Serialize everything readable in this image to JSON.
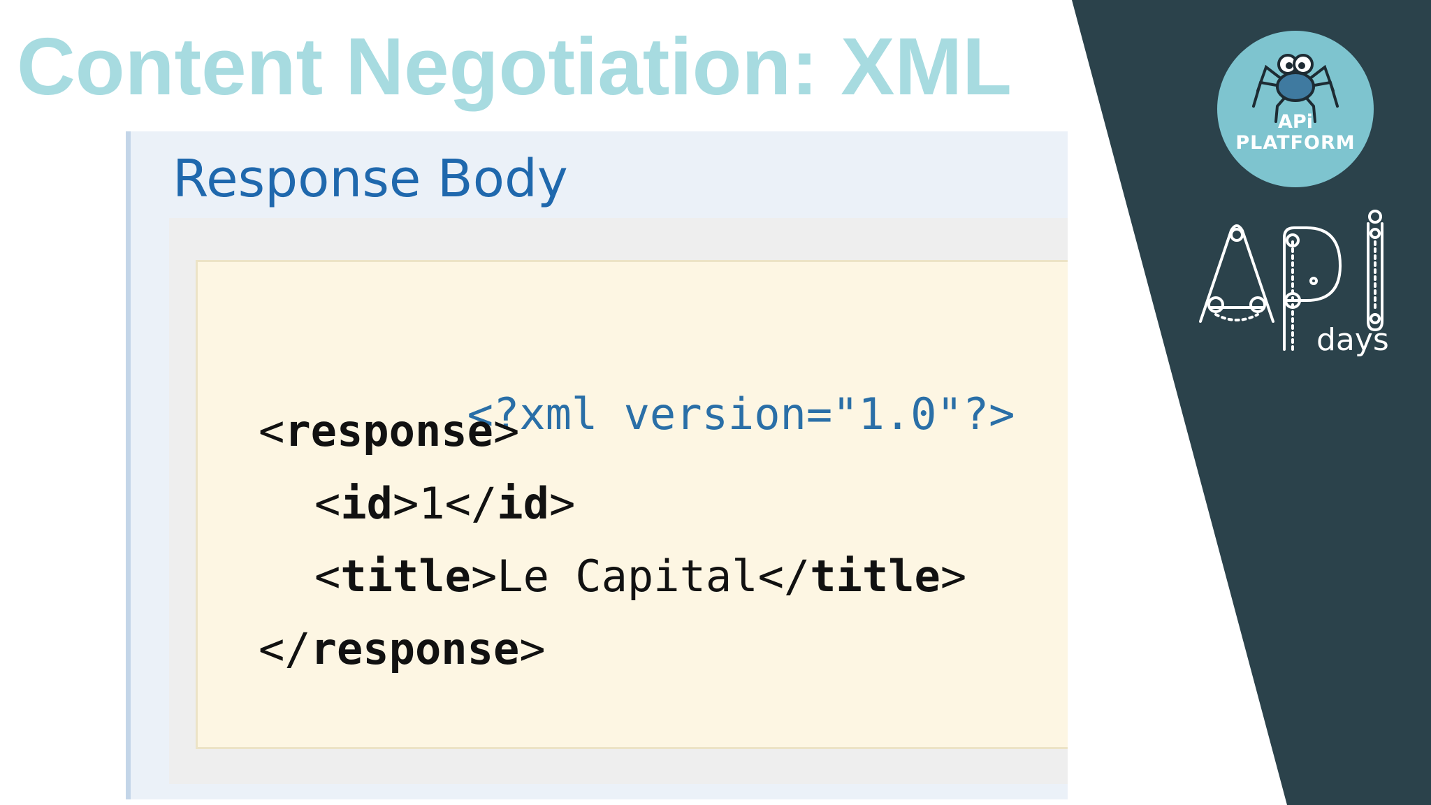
{
  "slide": {
    "title": "Content Negotiation: XML"
  },
  "panel": {
    "heading": "Response Body"
  },
  "code": {
    "declaration": "<?xml version=\"1.0\"?>",
    "root_open": "response",
    "id_tag": "id",
    "id_value": "1",
    "title_tag": "title",
    "title_value": "Le Capital",
    "root_close": "response"
  },
  "logos": {
    "platform_api": "APi",
    "platform_name": "PLATFORM",
    "apidays_suffix": "days"
  },
  "colors": {
    "title": "#a7dbe0",
    "dark_band": "#2b424b",
    "panel_heading": "#1f68ad",
    "code_background": "#fdf6e3",
    "logo_circle": "#7ec4cf"
  }
}
